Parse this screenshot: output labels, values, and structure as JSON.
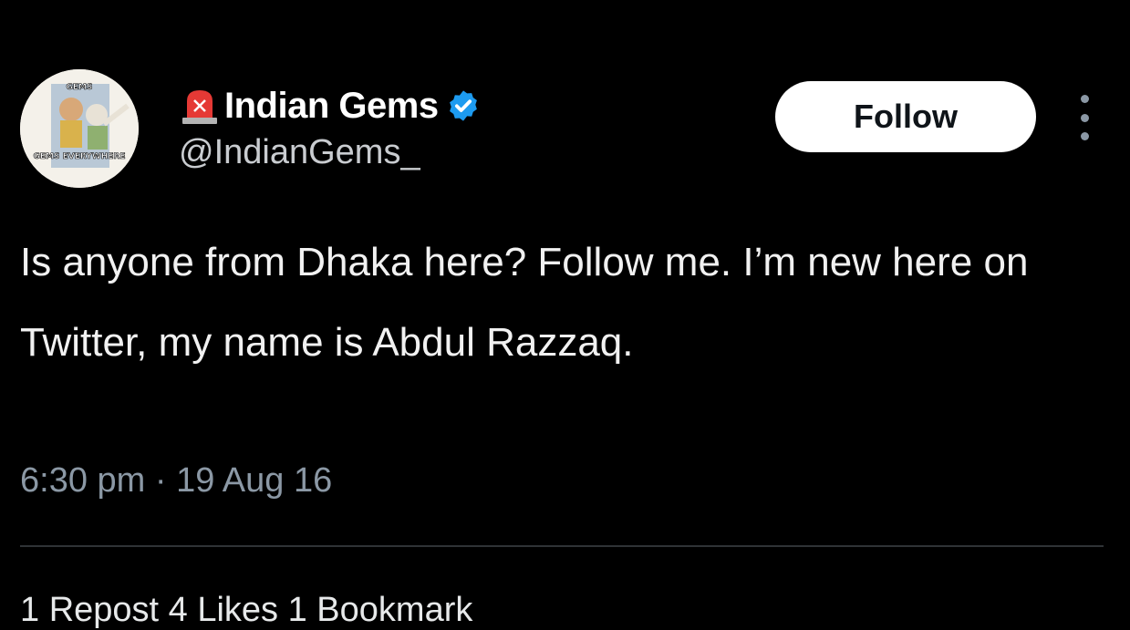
{
  "author": {
    "display_name": "Indian Gems",
    "handle": "@IndianGems_",
    "verified": true,
    "avatar_top_text": "GEMS",
    "avatar_bottom_text": "GEMS EVERYWHERE",
    "name_emoji_icon": "siren-icon",
    "verified_color": "#1d9bf0"
  },
  "actions": {
    "follow_label": "Follow",
    "more_icon": "more-vertical-icon"
  },
  "tweet": {
    "text": "Is anyone from Dhaka here? Follow me. I’m new here on Twitter, my name is Abdul Razzaq.",
    "timestamp": "6:30 pm · 19 Aug 16"
  },
  "stats": {
    "text": "1 Repost   4 Likes   1 Bookmark"
  }
}
